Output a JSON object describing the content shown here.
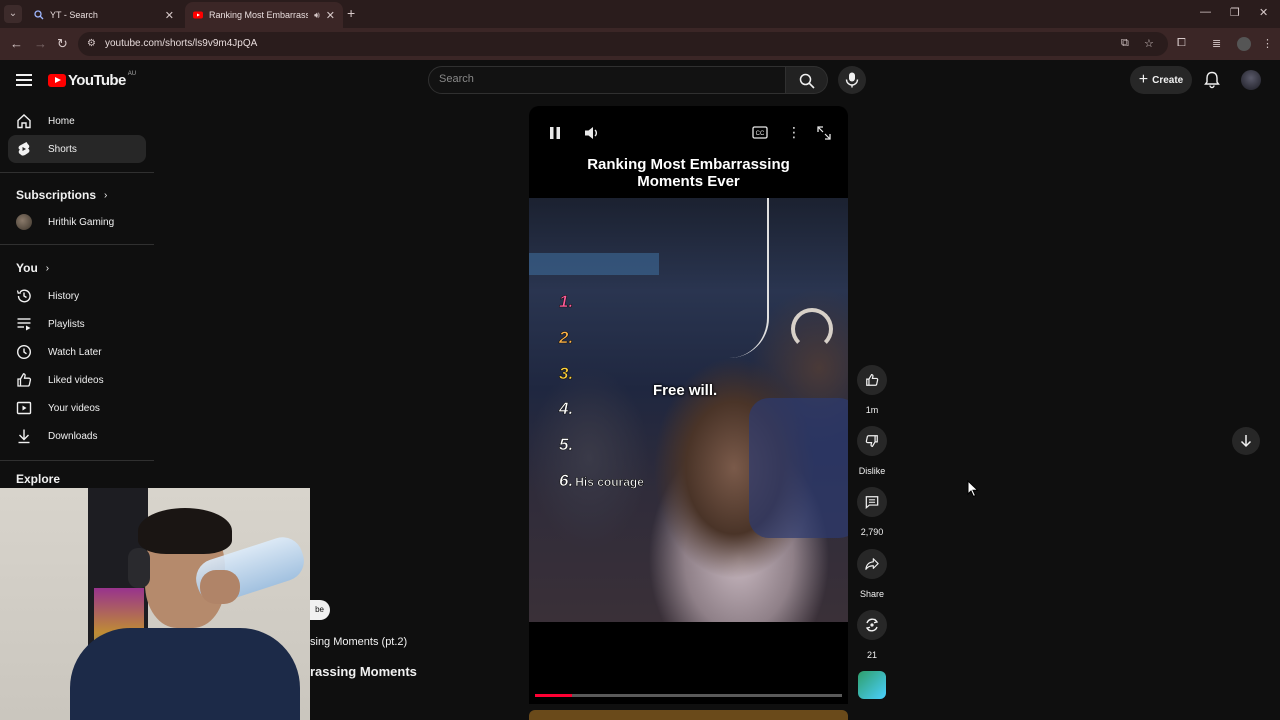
{
  "browser": {
    "tabs": [
      {
        "title": "YT - Search",
        "active": false
      },
      {
        "title": "Ranking Most Embarrassing",
        "active": true
      }
    ],
    "url": "youtube.com/shorts/ls9v9m4JpQA"
  },
  "header": {
    "logo_text": "YouTube",
    "country_code": "AU",
    "search_placeholder": "Search",
    "create_label": "Create"
  },
  "sidebar": {
    "primary": [
      {
        "label": "Home",
        "icon": "home-icon"
      },
      {
        "label": "Shorts",
        "icon": "shorts-icon",
        "active": true
      }
    ],
    "subscriptions_heading": "Subscriptions",
    "subscriptions": [
      {
        "label": "Hrithik Gaming"
      }
    ],
    "you_heading": "You",
    "you_items": [
      {
        "label": "History",
        "icon": "history-icon"
      },
      {
        "label": "Playlists",
        "icon": "playlists-icon"
      },
      {
        "label": "Watch Later",
        "icon": "watch-later-icon"
      },
      {
        "label": "Liked videos",
        "icon": "like-icon"
      },
      {
        "label": "Your videos",
        "icon": "your-videos-icon"
      },
      {
        "label": "Downloads",
        "icon": "download-icon"
      }
    ],
    "explore_heading": "Explore"
  },
  "short": {
    "title_line1": "Ranking Most Embarrassing",
    "title_line2": "Moments Ever",
    "ranks": [
      "1.",
      "2.",
      "3.",
      "4.",
      "5.",
      "6."
    ],
    "rank6_label": "His courage",
    "caption": "Free will.",
    "progress": 0.12
  },
  "actions": {
    "like_count": "1m",
    "dislike_label": "Dislike",
    "comment_count": "2,790",
    "share_label": "Share",
    "remix_count": "21"
  },
  "behind_overlay": {
    "pill_text": "be",
    "line1": "sing Moments (pt.2)",
    "line2": "rassing Moments"
  },
  "colors": {
    "accent": "#ff0033",
    "background": "#0f0f0f",
    "browser_frame": "#3b2626"
  }
}
